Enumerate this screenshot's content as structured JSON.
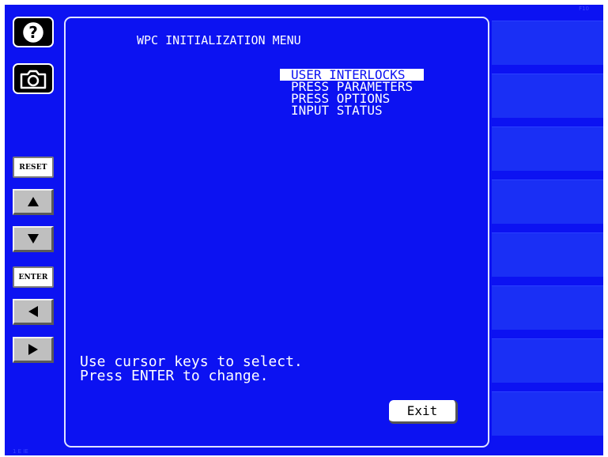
{
  "screen": {
    "title": "WPC INITIALIZATION MENU",
    "background_color": "#0c12f2",
    "corner_label_top_right": "F10",
    "corner_label_bottom_left": "1 E IE"
  },
  "sidebar": {
    "help_icon": "question-mark-icon",
    "camera_icon": "camera-icon",
    "reset_label": "RESET",
    "up_icon": "up-arrow-icon",
    "down_icon": "down-arrow-icon",
    "enter_label": "ENTER",
    "left_icon": "left-arrow-icon",
    "right_icon": "right-arrow-icon"
  },
  "menu": {
    "items": [
      {
        "label": "USER INTERLOCKS",
        "selected": true
      },
      {
        "label": "PRESS PARAMETERS",
        "selected": false
      },
      {
        "label": "PRESS OPTIONS",
        "selected": false
      },
      {
        "label": "INPUT STATUS",
        "selected": false
      }
    ]
  },
  "hints": {
    "line1": "Use cursor keys to select.",
    "line2": "Press ENTER to change."
  },
  "exit_label": "Exit",
  "soft_keys": [
    "",
    "",
    "",
    "",
    "",
    "",
    "",
    ""
  ]
}
